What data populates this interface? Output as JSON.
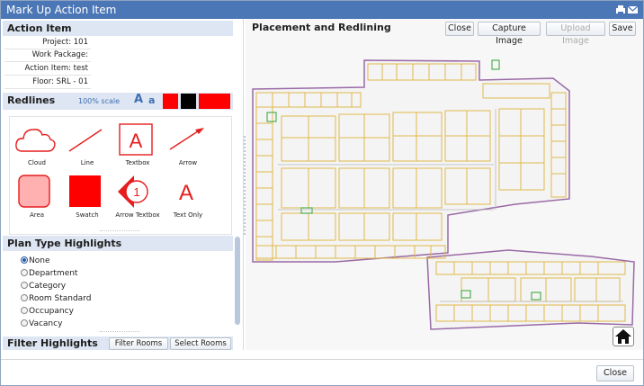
{
  "window": {
    "title": "Mark Up Action Item"
  },
  "action_item": {
    "heading": "Action Item",
    "project": "Project:  101",
    "work_package": "Work Package:",
    "action_item": "Action Item: test",
    "floor": "Floor: SRL - 01"
  },
  "redlines": {
    "heading": "Redlines",
    "scale": "100% scale",
    "font_large": "A",
    "font_small": "a",
    "tools": {
      "cloud": "Cloud",
      "line": "Line",
      "textbox": "Textbox",
      "arrow": "Arrow",
      "area": "Area",
      "swatch": "Swatch",
      "arrow_textbox": "Arrow Textbox",
      "text_only": "Text Only"
    },
    "textbox_glyph": "A",
    "arrow_textbox_glyph": "1",
    "text_only_glyph": "A"
  },
  "plan_type": {
    "heading": "Plan Type Highlights",
    "options": [
      "None",
      "Department",
      "Category",
      "Room Standard",
      "Occupancy",
      "Vacancy"
    ],
    "selected": "None"
  },
  "filter": {
    "heading": "Filter Highlights",
    "filter_rooms": "Filter Rooms",
    "select_rooms": "Select Rooms"
  },
  "placement": {
    "heading": "Placement and Redlining",
    "close": "Close",
    "capture": "Capture Image",
    "upload": "Upload Image",
    "save": "Save"
  },
  "footer": {
    "close": "Close"
  },
  "colors": {
    "titlebar": "#4c77b6",
    "red": "#ff0000",
    "section": "#dde6f2",
    "wall_yellow": "#e0b84a",
    "outline_purple": "#9a6aa6"
  }
}
